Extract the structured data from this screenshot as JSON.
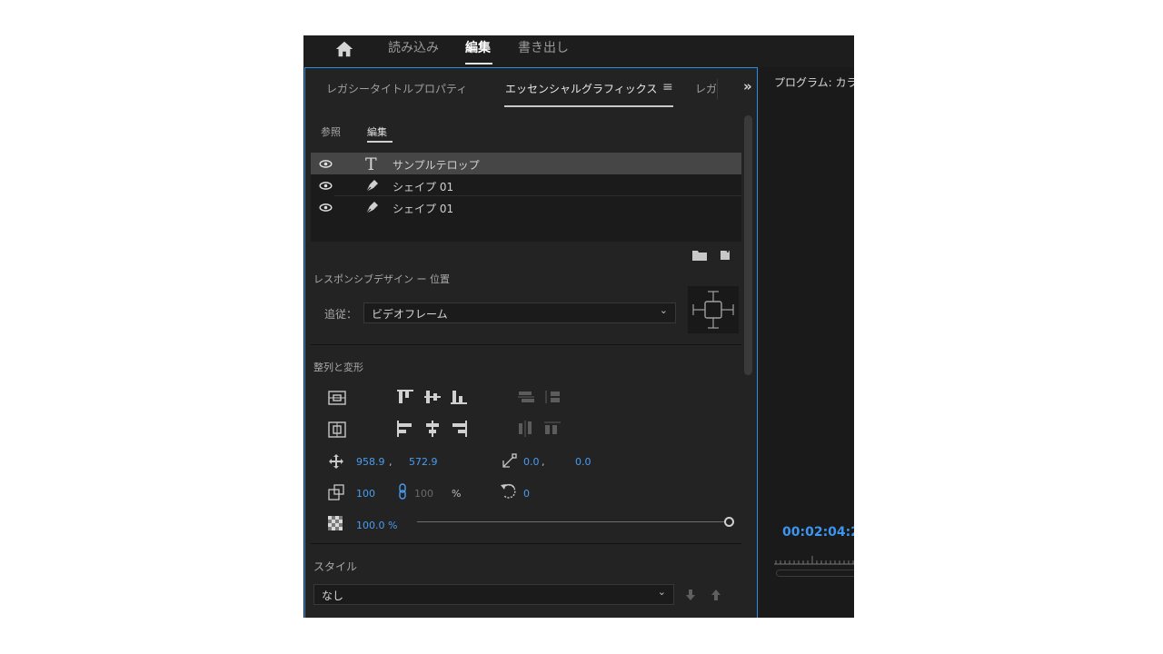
{
  "workspace": {
    "tabs": [
      {
        "label": "読み込み"
      },
      {
        "label": "編集"
      },
      {
        "label": "書き出し"
      }
    ],
    "active_tab": "編集"
  },
  "panel": {
    "tabs": [
      {
        "label": "レガシータイトルプロパティ"
      },
      {
        "label": "エッセンシャルグラフィックス"
      },
      {
        "label": "レガ"
      }
    ],
    "menu_icon": "hamburger-icon",
    "overflow_icon": "double-chevron-right-icon",
    "subtabs": [
      {
        "label": "参照"
      },
      {
        "label": "編集"
      }
    ],
    "layers": [
      {
        "name": "サンプルテロップ",
        "type": "text",
        "selected": true
      },
      {
        "name": "シェイプ 01",
        "type": "shape",
        "selected": false
      },
      {
        "name": "シェイプ 01",
        "type": "shape",
        "selected": false
      }
    ],
    "responsive": {
      "label": "レスポンシブデザイン ー 位置",
      "follow_label": "追従：",
      "follow_value": "ビデオフレーム"
    },
    "align": {
      "label": "整列と変形",
      "position_x": "958.9",
      "position_y": "572.9",
      "comma": ",",
      "anchor_x": "0.0",
      "anchor_y": "0.0",
      "scale": "100",
      "scale_height": "100",
      "percent_sign": "%",
      "rotation": "0",
      "opacity": "100.0 %"
    },
    "style": {
      "label": "スタイル",
      "value": "なし"
    }
  },
  "program": {
    "title": "プログラム: カラ",
    "timecode": "00:02:04:2"
  },
  "colors": {
    "accent_blue": "#4b9cf0",
    "panel_border": "#2d8ceb",
    "background": "#1d1d1d"
  }
}
